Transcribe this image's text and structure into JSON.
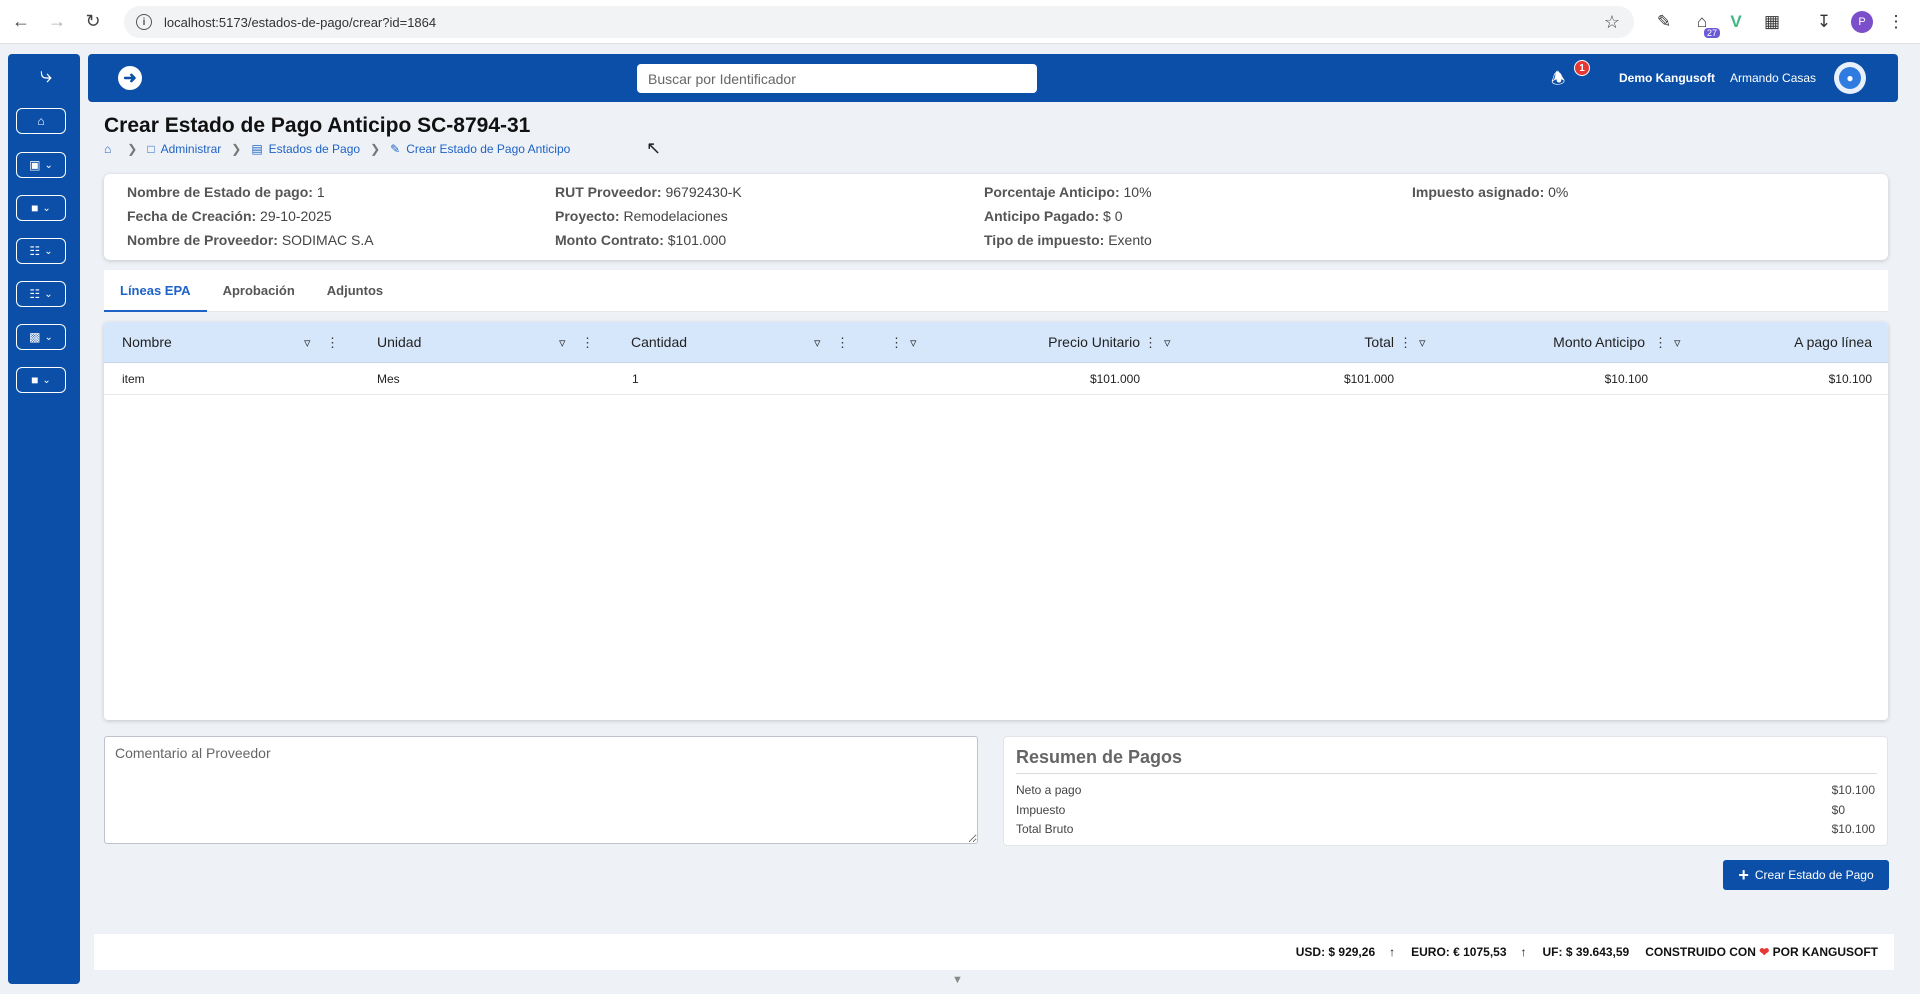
{
  "browser": {
    "url": "localhost:5173/estados-de-pago/crear?id=1864",
    "ext_badge": "27",
    "profile_initial": "P"
  },
  "header": {
    "search_placeholder": "Buscar por Identificador",
    "notification_count": "1",
    "company": "Demo Kangusoft",
    "user": "Armando Casas"
  },
  "page": {
    "title": "Crear Estado de Pago Anticipo SC-8794-31",
    "breadcrumb": [
      "Administrar",
      "Estados de Pago",
      "Crear Estado de Pago Anticipo"
    ]
  },
  "info": {
    "nombre_estado_label": "Nombre de Estado de pago:",
    "nombre_estado_value": "1",
    "fecha_label": "Fecha de Creación:",
    "fecha_value": "29-10-2025",
    "proveedor_label": "Nombre de Proveedor:",
    "proveedor_value": "SODIMAC S.A",
    "rut_label": "RUT Proveedor:",
    "rut_value": "96792430-K",
    "proyecto_label": "Proyecto:",
    "proyecto_value": "Remodelaciones",
    "monto_label": "Monto Contrato:",
    "monto_value": "$101.000",
    "porcentaje_label": "Porcentaje Anticipo:",
    "porcentaje_value": "10%",
    "anticipo_label": "Anticipo Pagado:",
    "anticipo_value": "$ 0",
    "tipo_label": "Tipo de impuesto:",
    "tipo_value": "Exento",
    "impuesto_label": "Impuesto asignado:",
    "impuesto_value": "0%"
  },
  "tabs": [
    "Líneas EPA",
    "Aprobación",
    "Adjuntos"
  ],
  "table": {
    "columns": [
      "Nombre",
      "Unidad",
      "Cantidad",
      "Precio Unitario",
      "Total",
      "Monto Anticipo",
      "A pago línea"
    ],
    "rows": [
      [
        "item",
        "Mes",
        "1",
        "$101.000",
        "$101.000",
        "$10.100",
        "$10.100"
      ]
    ]
  },
  "comment": {
    "placeholder": "Comentario al Proveedor"
  },
  "summary": {
    "title": "Resumen de Pagos",
    "lines": [
      {
        "label": "Neto a pago",
        "value": "$10.100"
      },
      {
        "label": "Impuesto",
        "value": "$0"
      },
      {
        "label": "Total Bruto",
        "value": "$10.100"
      }
    ]
  },
  "actions": {
    "create_label": "Crear Estado de Pago"
  },
  "footer": {
    "usd": "USD: $ 929,26",
    "euro": "EURO: € 1075,53",
    "uf": "UF: $ 39.643,59",
    "built_prefix": "CONSTRUIDO CON",
    "built_suffix": "POR KANGUSOFT"
  }
}
